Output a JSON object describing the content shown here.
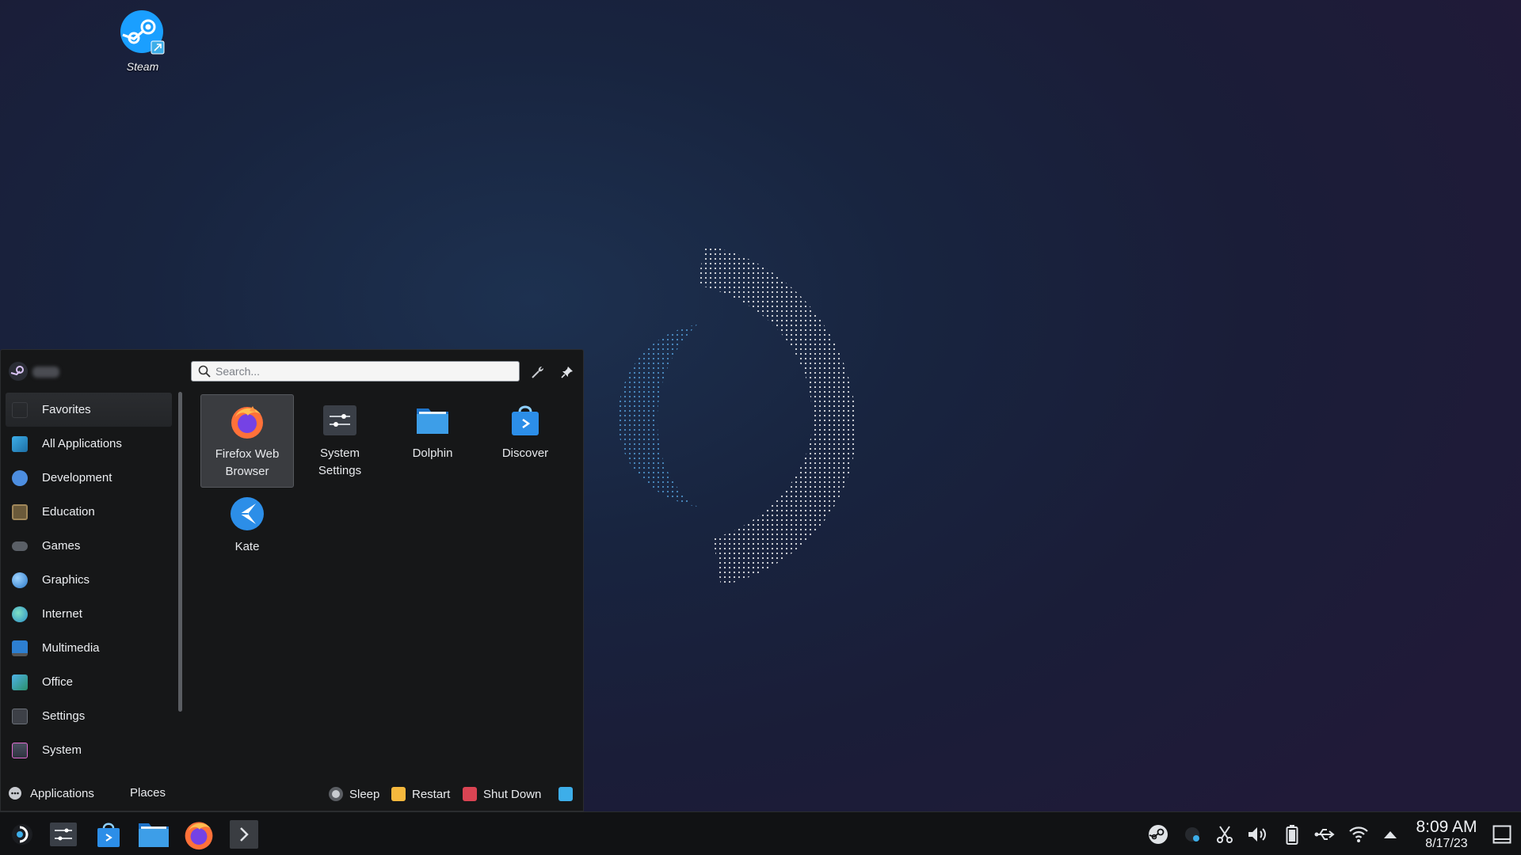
{
  "desktop": {
    "icons": [
      {
        "label": "Steam",
        "icon": "steam-icon"
      }
    ]
  },
  "launcher": {
    "search": {
      "placeholder": "Search..."
    },
    "categories": [
      {
        "label": "Favorites",
        "icon": "favorites-icon",
        "active": true
      },
      {
        "label": "All Applications",
        "icon": "all-applications-icon"
      },
      {
        "label": "Development",
        "icon": "development-icon"
      },
      {
        "label": "Education",
        "icon": "education-icon"
      },
      {
        "label": "Games",
        "icon": "games-icon"
      },
      {
        "label": "Graphics",
        "icon": "graphics-icon"
      },
      {
        "label": "Internet",
        "icon": "internet-icon"
      },
      {
        "label": "Multimedia",
        "icon": "multimedia-icon"
      },
      {
        "label": "Office",
        "icon": "office-icon"
      },
      {
        "label": "Settings",
        "icon": "settings-icon"
      },
      {
        "label": "System",
        "icon": "system-icon"
      }
    ],
    "favorites": [
      {
        "label": "Firefox Web Browser",
        "icon": "firefox-icon",
        "selected": true
      },
      {
        "label": "System Settings",
        "icon": "system-settings-icon"
      },
      {
        "label": "Dolphin",
        "icon": "dolphin-folder-icon"
      },
      {
        "label": "Discover",
        "icon": "discover-icon"
      },
      {
        "label": "Kate",
        "icon": "kate-icon"
      }
    ],
    "footer": {
      "tabs": {
        "applications": "Applications",
        "places": "Places"
      },
      "power": {
        "sleep": "Sleep",
        "restart": "Restart",
        "shutdown": "Shut Down"
      }
    }
  },
  "taskbar": {
    "pinned": [
      "app-launcher-icon",
      "system-settings-icon",
      "discover-icon",
      "dolphin-icon",
      "firefox-icon",
      "konsole-icon"
    ],
    "tray": [
      "steam-tray-icon",
      "steam-status-icon",
      "spectacle-scissors-icon",
      "volume-icon",
      "battery-icon",
      "usb-icon",
      "wifi-icon",
      "expand-tray-icon"
    ],
    "clock": {
      "time": "8:09 AM",
      "date": "8/17/23"
    }
  },
  "colors": {
    "accent": "#3daee9",
    "panel": "#161718",
    "taskbar": "#111214",
    "firefox": "#ff7139",
    "steam": "#1a9fff"
  }
}
